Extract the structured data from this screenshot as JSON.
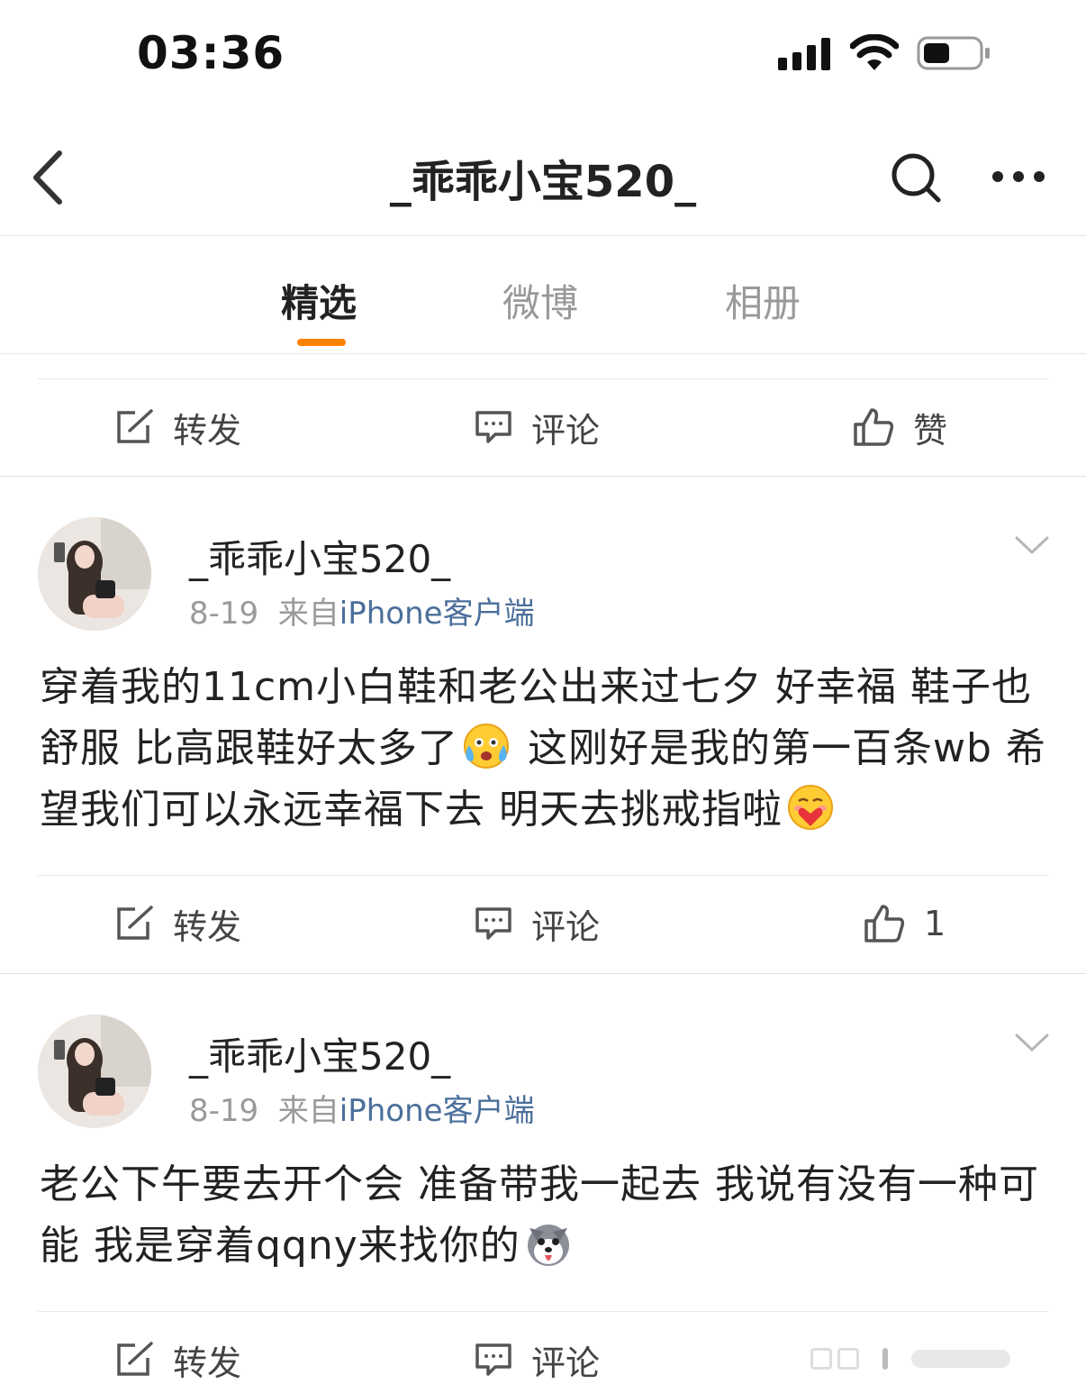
{
  "status_bar": {
    "time": "03:36"
  },
  "nav": {
    "title": "_乖乖小宝520_"
  },
  "tabs": [
    {
      "label": "精选",
      "active": true
    },
    {
      "label": "微博",
      "active": false
    },
    {
      "label": "相册",
      "active": false
    }
  ],
  "colors": {
    "accent": "#ff8200",
    "link": "#4b6f9b"
  },
  "top_action_bar": {
    "repost_label": "转发",
    "comment_label": "评论",
    "like_label": "赞"
  },
  "posts": [
    {
      "author": "_乖乖小宝520_",
      "date": "8-19",
      "source_prefix": "来自",
      "source": "iPhone客户端",
      "text_part1": "穿着我的11cm小白鞋和老公出来过七夕 好幸福 鞋子也舒服 比高跟鞋好太多了",
      "emoji1": "crying-laugh-emoji",
      "text_part2": " 这刚好是我的第一百条wb 希望我们可以永远幸福下去 明天去挑戒指啦",
      "emoji2": "heart-hug-emoji",
      "repost_label": "转发",
      "comment_label": "评论",
      "like_count": "1"
    },
    {
      "author": "_乖乖小宝520_",
      "date": "8-19",
      "source_prefix": "来自",
      "source": "iPhone客户端",
      "text_part1": "老公下午要去开个会 准备带我一起去 我说有没有一种可能 我是穿着qqny来找你的",
      "emoji1": "husky-dog-emoji",
      "repost_label": "转发",
      "comment_label": "评论"
    }
  ]
}
